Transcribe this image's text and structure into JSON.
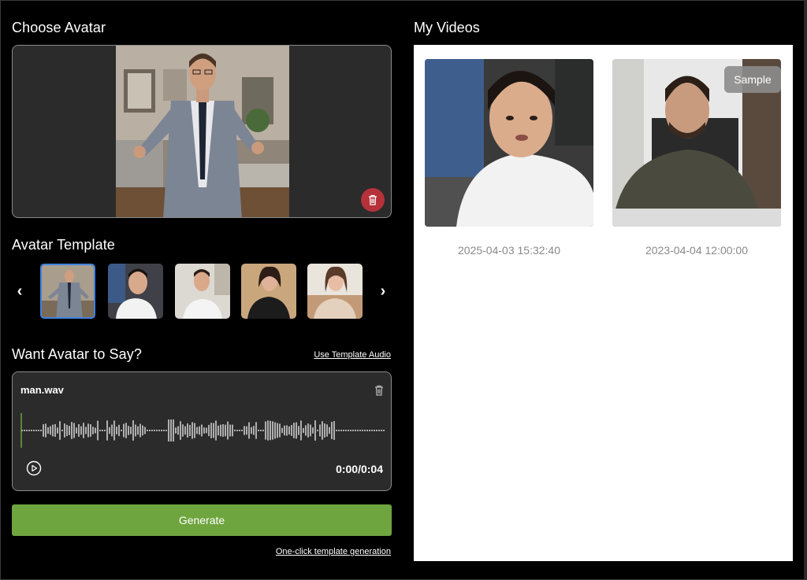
{
  "left": {
    "choose_avatar_title": "Choose Avatar",
    "avatar_template_title": "Avatar Template",
    "want_say_title": "Want Avatar to Say?",
    "use_template_audio": "Use Template Audio",
    "prev_arrow": "‹",
    "next_arrow": "›",
    "audio": {
      "file_name": "man.wav",
      "time": "0:00/0:04",
      "progress": 0
    },
    "generate_label": "Generate",
    "one_click_label": "One-click template generation",
    "templates": [
      {
        "name": "template-1",
        "selected": true
      },
      {
        "name": "template-2",
        "selected": false
      },
      {
        "name": "template-3",
        "selected": false
      },
      {
        "name": "template-4",
        "selected": false
      },
      {
        "name": "template-5",
        "selected": false
      }
    ]
  },
  "right": {
    "my_videos_title": "My Videos",
    "videos": [
      {
        "date": "2025-04-03 15:32:40",
        "badge": ""
      },
      {
        "date": "2023-04-04 12:00:00",
        "badge": "Sample"
      }
    ]
  },
  "colors": {
    "accent_green": "#6fa53f",
    "delete_red": "#b5323a",
    "selection_blue": "#3f82e0",
    "card_bg": "#2b2b2b"
  },
  "icons": [
    "trash-icon",
    "play-icon",
    "chevron-left-icon",
    "chevron-right-icon"
  ]
}
